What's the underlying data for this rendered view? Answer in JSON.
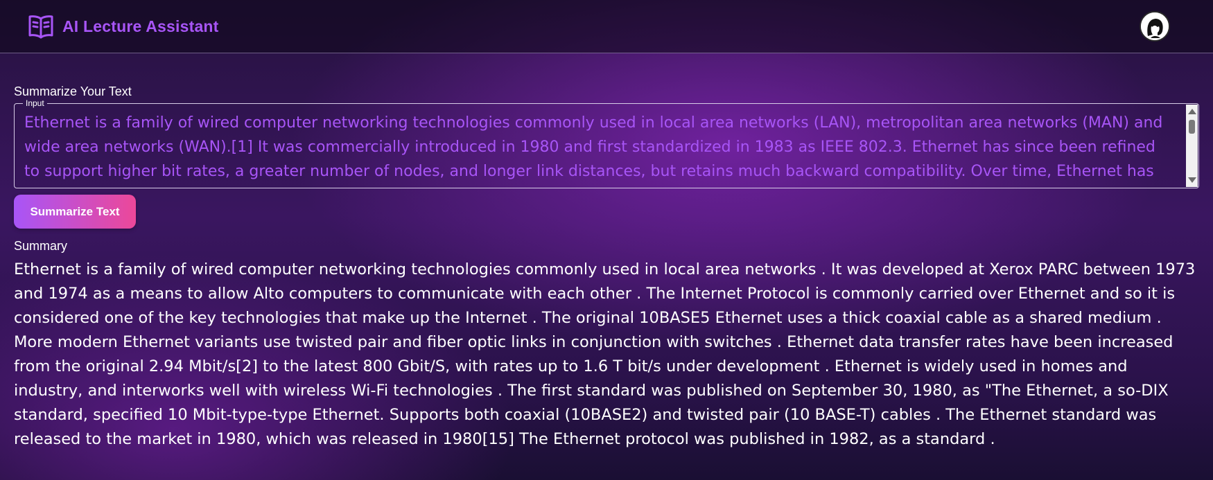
{
  "header": {
    "title": "AI Lecture Assistant",
    "logo_icon": "open-book-icon",
    "avatar_icon": "user-avatar",
    "accent_color": "#a855f7"
  },
  "main": {
    "summarize_heading": "Summarize Your Text",
    "input": {
      "legend": "Input",
      "value": "Ethernet is a family of wired computer networking technologies commonly used in local area networks (LAN), metropolitan area networks (MAN) and wide area networks (WAN).[1] It was commercially introduced in 1980 and first standardized in 1983 as IEEE 802.3. Ethernet has since been refined to support higher bit rates, a greater number of nodes, and longer link distances, but retains much backward compatibility. Over time, Ethernet has"
    },
    "summarize_button_label": "Summarize Text",
    "button_gradient": [
      "#a855f7",
      "#ec4899"
    ],
    "summary_heading": "Summary",
    "summary_text": "Ethernet is a family of wired computer networking technologies commonly used in local area networks . It was developed at Xerox PARC between 1973 and 1974 as a means to allow Alto computers to communicate with each other . The Internet Protocol is commonly carried over Ethernet and so it is considered one of the key technologies that make up the Internet . The original 10BASE5 Ethernet uses a thick coaxial cable as a shared medium . More modern Ethernet variants use twisted pair and fiber optic links in conjunction with switches . Ethernet data transfer rates have been increased from the original 2.94 Mbit/s[2] to the latest 800 Gbit/S, with rates up to 1.6 T bit/s under development . Ethernet is widely used in homes and industry, and interworks well with wireless Wi-Fi technologies . The first standard was published on September 30, 1980, as \"The Ethernet, a so-DIX standard, specified 10 Mbit-type-type Ethernet. Supports both coaxial (10BASE2) and twisted pair (10 BASE-T) cables . The Ethernet standard was released to the market in 1980, which was released in 1980[15] The Ethernet protocol was published in 1982, as a standard ."
  }
}
